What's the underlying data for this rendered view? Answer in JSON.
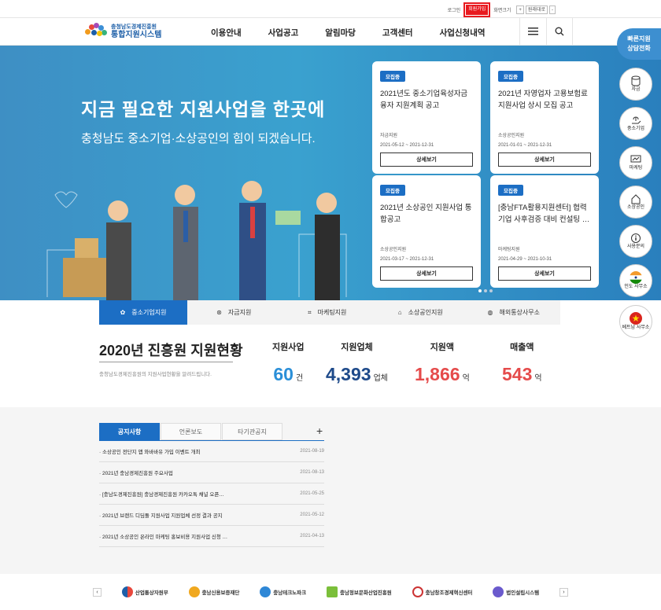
{
  "util": {
    "login": "로그인",
    "join": "회원가입",
    "zoom": "화면크기",
    "plus": "+",
    "reset": "원래대로",
    "minus": "-"
  },
  "logo": {
    "line1": "충청남도경제진흥원",
    "line2": "통합지원시스템"
  },
  "gnb": [
    "이용안내",
    "사업공고",
    "알림마당",
    "고객센터",
    "사업신청내역"
  ],
  "hero": {
    "title": "지금 필요한 지원사업을 한곳에",
    "subtitle": "충청남도 중소기업·소상공인의 힘이 되겠습니다."
  },
  "cards": [
    {
      "badge": "모집중",
      "title": "2021년도 중소기업육성자금 융자 지원계획 공고",
      "org": "자금지원",
      "date": "2021-05-12 ~ 2021-12-31",
      "btn": "상세보기"
    },
    {
      "badge": "모집중",
      "title": "2021년 자영업자 고용보험료 지원사업 상시 모집 공고",
      "org": "소상공인지원",
      "date": "2021-01-01 ~ 2021-12-31",
      "btn": "상세보기"
    },
    {
      "badge": "모집중",
      "title": "2021년 소상공인 지원사업 통합공고",
      "org": "소상공인지원",
      "date": "2021-03-17 ~ 2021-12-31",
      "btn": "상세보기"
    },
    {
      "badge": "모집중",
      "title": "[충남FTA활용지원센터] 협력기업 사후검증 대비 컨설팅 …",
      "org": "마케팅지원",
      "date": "2021-04-29 ~ 2021-10-31",
      "btn": "상세보기"
    }
  ],
  "quick": {
    "head1": "빠른지원",
    "head2": "상담전화",
    "items": [
      "자금",
      "중소기업",
      "마케팅",
      "소상공인",
      "사용문의",
      "인도 사무소",
      "베트남 사무소"
    ]
  },
  "tabs": [
    "중소기업지원",
    "자금지원",
    "마케팅지원",
    "소상공인지원",
    "해외통상사무소"
  ],
  "stats": {
    "title": "2020년 진흥원 지원현황",
    "sub": "충청남도경제진흥원의 지원사업현황을 알려드립니다.",
    "items": [
      {
        "label": "지원사업",
        "value": "60",
        "unit": "건",
        "color": "#2a8fd8"
      },
      {
        "label": "지원업체",
        "value": "4,393",
        "unit": "업체",
        "color": "#1e4a8a"
      },
      {
        "label": "지원액",
        "value": "1,866",
        "unit": "억",
        "color": "#e54b4b"
      },
      {
        "label": "매출액",
        "value": "543",
        "unit": "억",
        "color": "#e54b4b"
      }
    ]
  },
  "notice": {
    "tabs": [
      "공지사항",
      "언론보도",
      "타기관공지"
    ],
    "plus": "+",
    "rows": [
      {
        "t": "· 소상공인 전단지 앱 와바바유 가입 이벤트 개최",
        "d": "2021-08-19"
      },
      {
        "t": "· 2021년 충남경제진흥원 주요사업",
        "d": "2021-08-13"
      },
      {
        "t": "· [충남도경제진흥원] 충남경제진흥원 카카오톡 채널 오픈…",
        "d": "2021-05-25"
      },
      {
        "t": "· 2021년 브랜드 디딤돌 지원사업 지원업체 선정 결과 공지",
        "d": "2021-05-12"
      },
      {
        "t": "· 2021년 소상공인 온라인 마케팅 홍보비용 지원사업 신청 …",
        "d": "2021-04-13"
      }
    ]
  },
  "partners": {
    "prev": "‹",
    "next": "›",
    "items": [
      "산업통상자원부",
      "충남신용보증재단",
      "충남테크노파크",
      "충남정보문화산업진흥원",
      "충남창조경제혁신센터",
      "법인설립시스템"
    ]
  }
}
